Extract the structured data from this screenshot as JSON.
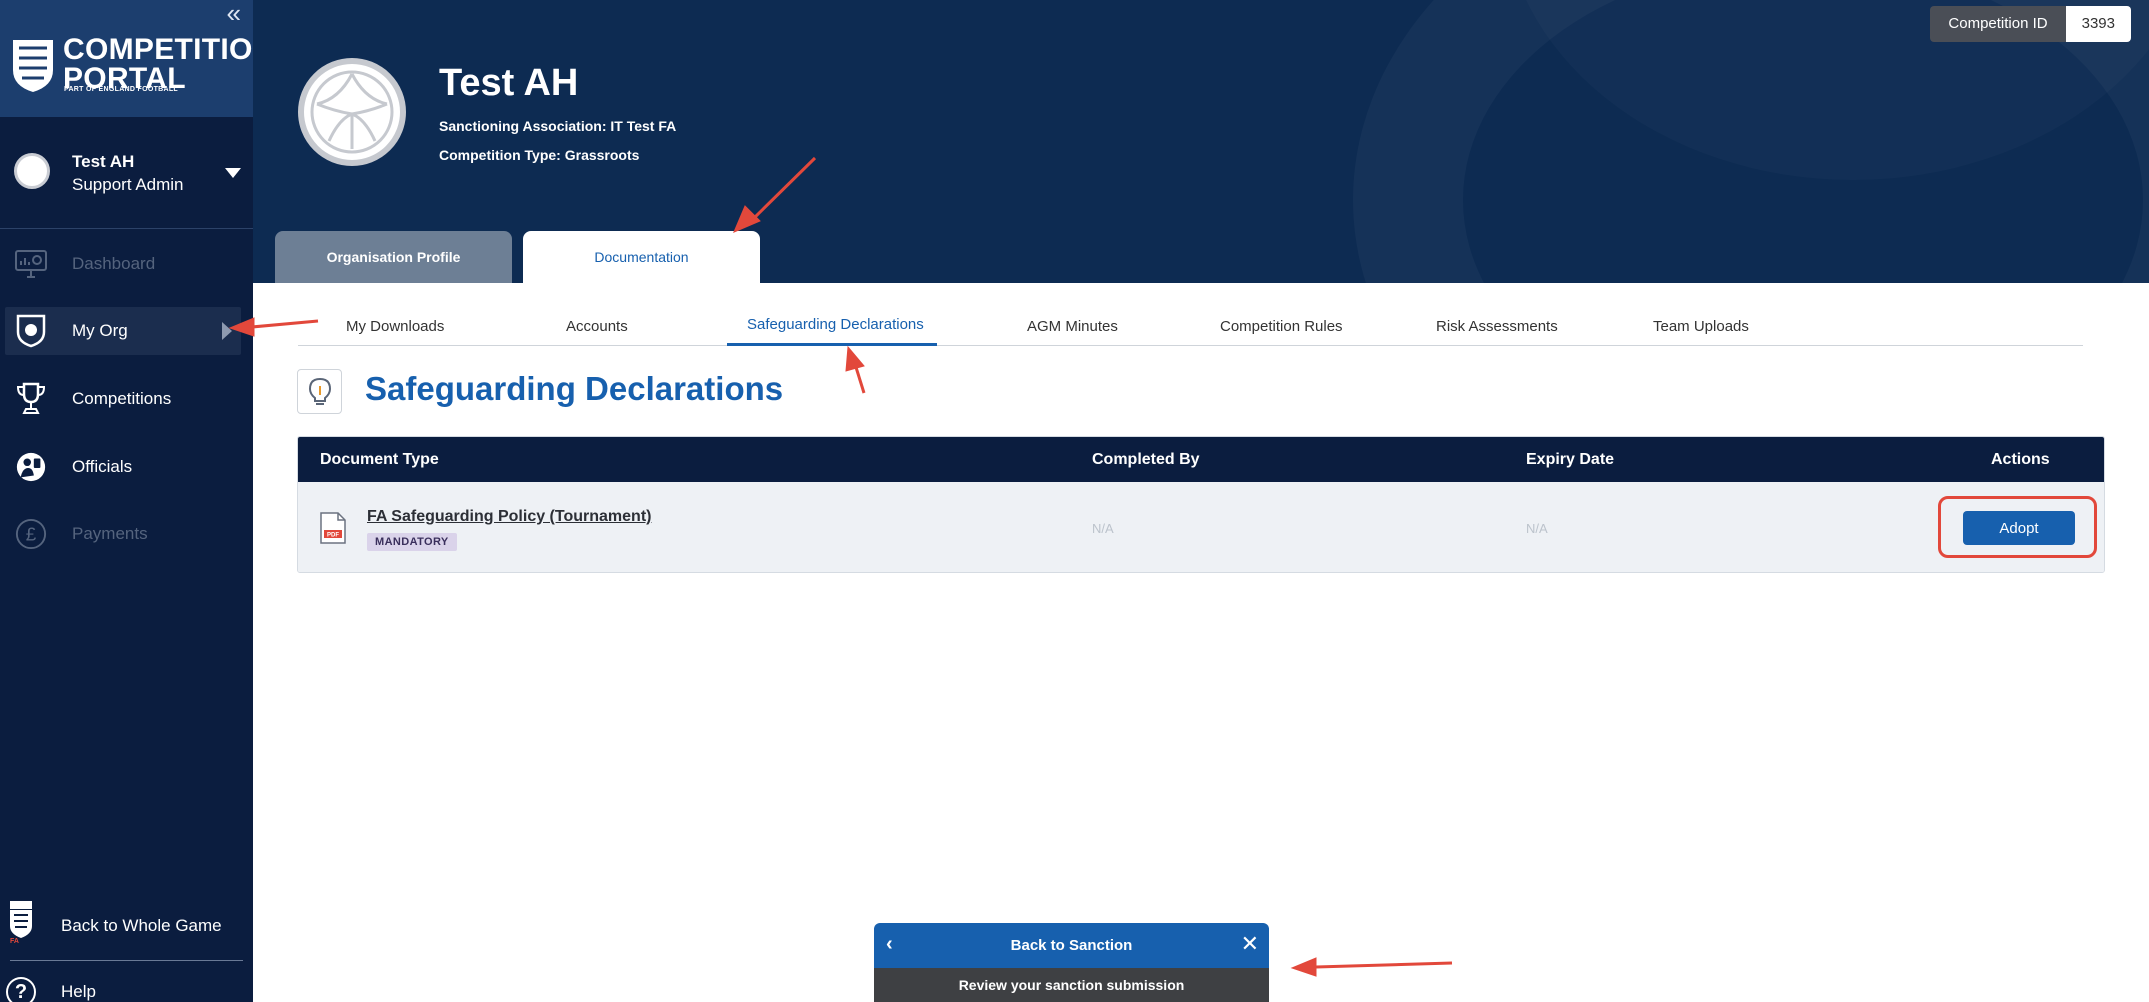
{
  "sidebar": {
    "collapse_glyph": "«",
    "logo": {
      "title_line1": "COMPETITION",
      "title_line2": "PORTAL",
      "subtitle": "PART OF ENGLAND FOOTBALL"
    },
    "user": {
      "name": "Test AH",
      "role": "Support Admin"
    },
    "nav": [
      {
        "label": "Dashboard",
        "icon": "dashboard-icon",
        "enabled": false
      },
      {
        "label": "My Org",
        "icon": "shield-icon",
        "enabled": true,
        "active": true
      },
      {
        "label": "Competitions",
        "icon": "trophy-icon",
        "enabled": true
      },
      {
        "label": "Officials",
        "icon": "officials-icon",
        "enabled": true
      },
      {
        "label": "Payments",
        "icon": "pound-icon",
        "enabled": false
      }
    ],
    "back_label": "Back to Whole Game",
    "crest_text": "FA",
    "help_label": "Help"
  },
  "header": {
    "org_name": "Test AH",
    "sanctioning_label": "Sanctioning Association:",
    "sanctioning_value": "IT Test FA",
    "type_label": "Competition Type:",
    "type_value": "Grassroots",
    "competition_id_label": "Competition ID",
    "competition_id_value": "3393",
    "tabs": [
      {
        "label": "Organisation Profile",
        "active": false
      },
      {
        "label": "Documentation",
        "active": true
      }
    ]
  },
  "subtabs": [
    {
      "label": "My Downloads"
    },
    {
      "label": "Accounts"
    },
    {
      "label": "Safeguarding Declarations",
      "active": true
    },
    {
      "label": "AGM Minutes"
    },
    {
      "label": "Competition Rules"
    },
    {
      "label": "Risk Assessments"
    },
    {
      "label": "Team Uploads"
    }
  ],
  "page": {
    "title": "Safeguarding Declarations"
  },
  "table": {
    "columns": [
      "Document Type",
      "Completed By",
      "Expiry Date",
      "Actions"
    ],
    "rows": [
      {
        "document": "FA Safeguarding Policy (Tournament)",
        "badge": "MANDATORY",
        "file_type": "PDF",
        "completed_by": "N/A",
        "expiry": "N/A",
        "action": "Adopt"
      }
    ]
  },
  "sanction_widget": {
    "title": "Back to Sanction",
    "message": "Review your sanction submission"
  },
  "colors": {
    "sidebar": "#0b1d3f",
    "header": "#0d2b52",
    "accent": "#1760ae",
    "annotation": "#e2483b"
  }
}
